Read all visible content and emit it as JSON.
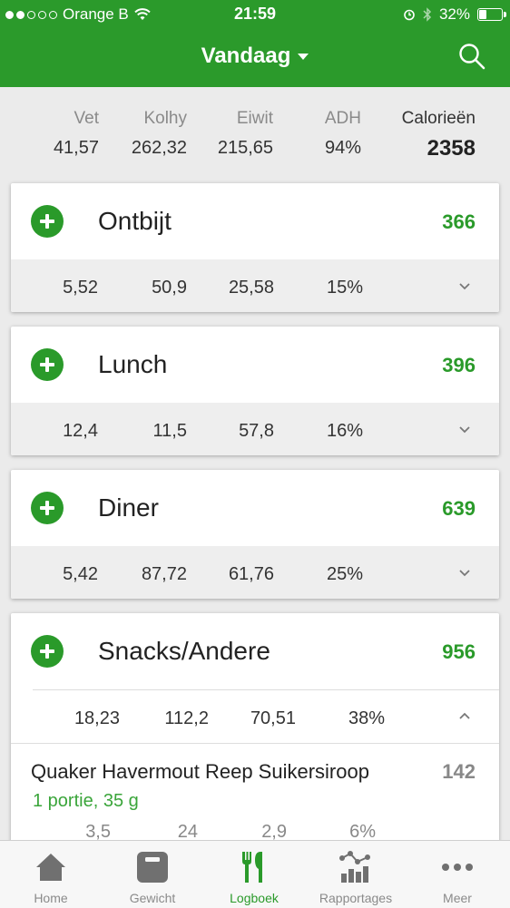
{
  "status_bar": {
    "carrier": "Orange B",
    "time": "21:59",
    "battery": "32%",
    "battery_level": 0.32
  },
  "header": {
    "title": "Vandaag"
  },
  "summary": {
    "fat_label": "Vet",
    "fat_value": "41,57",
    "carbs_label": "Kolhy",
    "carbs_value": "262,32",
    "protein_label": "Eiwit",
    "protein_value": "215,65",
    "adh_label": "ADH",
    "adh_value": "94%",
    "calories_label": "Calorieën",
    "calories_value": "2358"
  },
  "meals": [
    {
      "name": "Ontbijt",
      "calories": "366",
      "fat": "5,52",
      "carbs": "50,9",
      "protein": "25,58",
      "adh": "15%"
    },
    {
      "name": "Lunch",
      "calories": "396",
      "fat": "12,4",
      "carbs": "11,5",
      "protein": "57,8",
      "adh": "16%"
    },
    {
      "name": "Diner",
      "calories": "639",
      "fat": "5,42",
      "carbs": "87,72",
      "protein": "61,76",
      "adh": "25%"
    },
    {
      "name": "Snacks/Andere",
      "calories": "956",
      "fat": "18,23",
      "carbs": "112,2",
      "protein": "70,51",
      "adh": "38%",
      "items": [
        {
          "name": "Quaker Havermout Reep Suikersiroop",
          "calories": "142",
          "portion": "1 portie, 35 g",
          "fat": "3,5",
          "carbs": "24",
          "protein": "2,9",
          "adh": "6%"
        }
      ]
    }
  ],
  "tabs": [
    {
      "label": "Home",
      "icon": "home-icon"
    },
    {
      "label": "Gewicht",
      "icon": "scale-icon"
    },
    {
      "label": "Logboek",
      "icon": "cutlery-icon",
      "active": true
    },
    {
      "label": "Rapportages",
      "icon": "chart-icon"
    },
    {
      "label": "Meer",
      "icon": "more-icon"
    }
  ],
  "colors": {
    "brand_green": "#2b9a2b",
    "accent_green": "#2a9a2a"
  }
}
